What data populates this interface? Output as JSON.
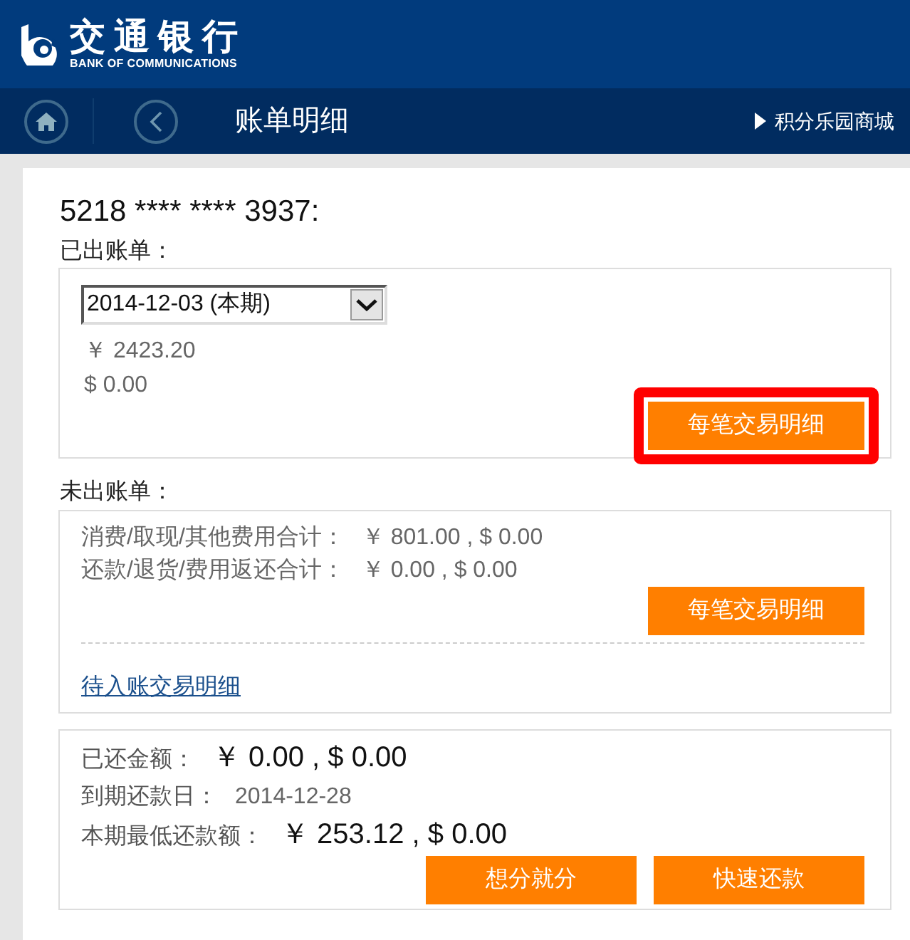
{
  "header": {
    "logo_chinese": "交通银行",
    "logo_english": "BANK OF COMMUNICATIONS"
  },
  "nav": {
    "title": "账单明细",
    "link": "积分乐园商城"
  },
  "card_number": "5218 **** **** 3937:",
  "billed": {
    "heading": "已出账单：",
    "period_select": {
      "value": "2014-12-03 (本期)"
    },
    "amounts": [
      "￥ 2423.20",
      "$ 0.00"
    ],
    "button": {
      "label": "每笔交易明细",
      "highlighted": true
    }
  },
  "unbilled": {
    "heading": "未出账单：",
    "rows": [
      {
        "label": "消费/取现/其他费用合计：",
        "value": "￥ 801.00 , $ 0.00"
      },
      {
        "label": "还款/退货/费用返还合计：",
        "value": "￥ 0.00 , $ 0.00"
      }
    ],
    "button": {
      "label": "每笔交易明细",
      "highlighted": false
    },
    "link": "待入账交易明细"
  },
  "repayment": {
    "rows": [
      {
        "kind": "emphasis",
        "label": "已还金额：",
        "value": "￥ 0.00 , $ 0.00"
      },
      {
        "kind": "plain",
        "label": "到期还款日：",
        "value": "2014-12-28"
      },
      {
        "kind": "emphasis",
        "label": "本期最低还款额：",
        "value": "￥ 253.12 , $ 0.00"
      }
    ],
    "buttons": [
      {
        "label": "想分就分"
      },
      {
        "label": "快速还款"
      }
    ]
  }
}
